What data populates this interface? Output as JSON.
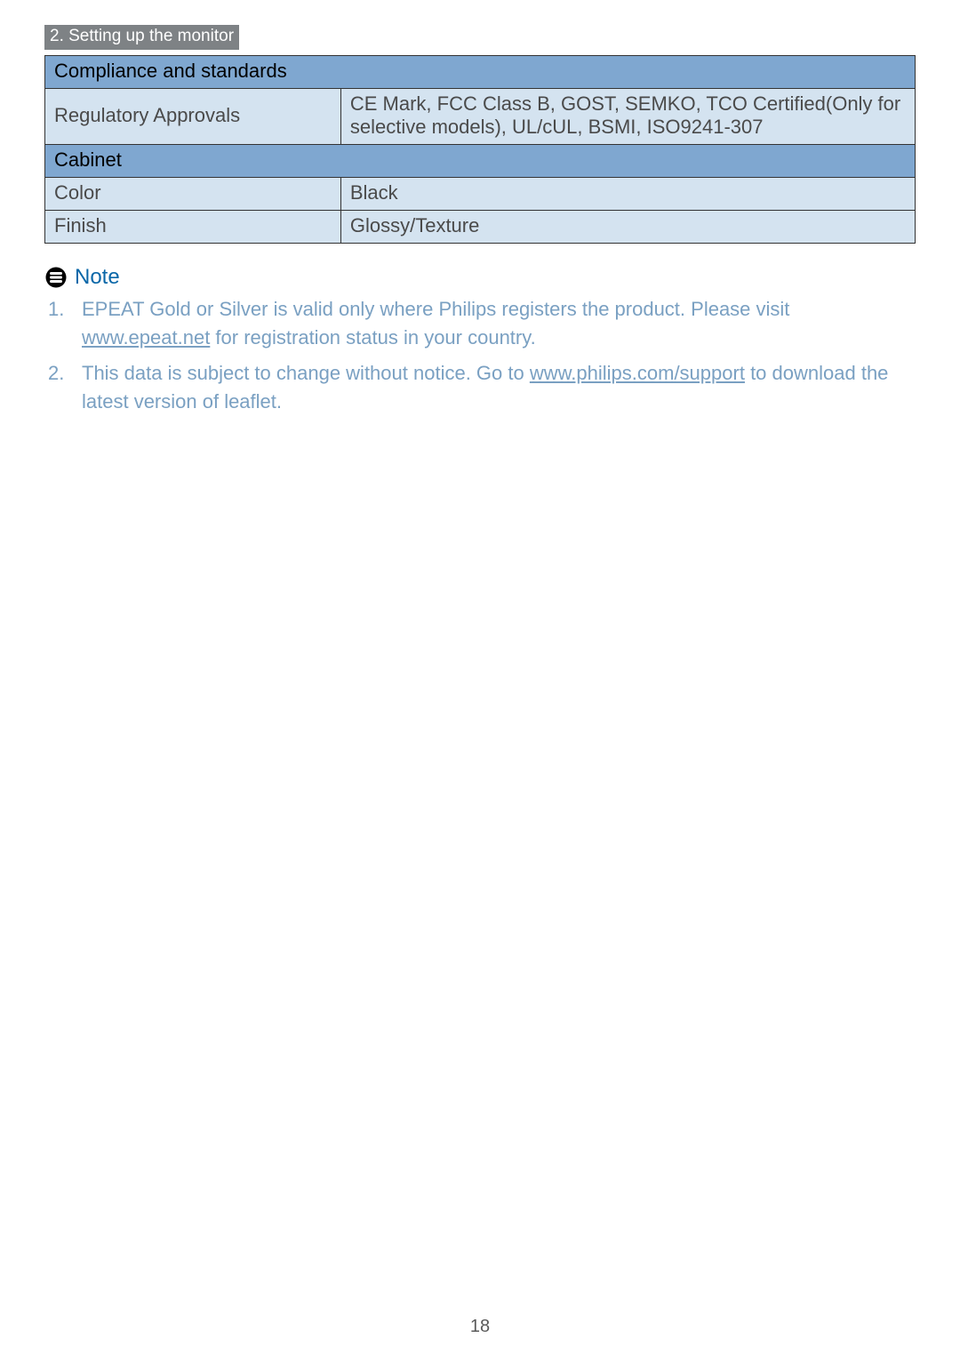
{
  "section_header": "2. Setting up the monitor",
  "table": {
    "group1_header": "Compliance and standards",
    "group1_rows": [
      {
        "label": "Regulatory Approvals",
        "value": "CE Mark, FCC Class B, GOST, SEMKO, TCO Certified(Only for selective models), UL/cUL,  BSMI, ISO9241-307"
      }
    ],
    "group2_header": "Cabinet",
    "group2_rows": [
      {
        "label": "Color",
        "value": "Black"
      },
      {
        "label": "Finish",
        "value": "Glossy/Texture"
      }
    ]
  },
  "note": {
    "title": "Note",
    "items": [
      {
        "pre": "EPEAT Gold or Silver is valid only where Philips registers the product. Please visit ",
        "link": "www.epeat.net",
        "post": " for registration status in your country."
      },
      {
        "pre": "This data is subject to change without notice. Go to ",
        "link": "www.philips.com/support",
        "post": " to download the latest version of leaflet."
      }
    ]
  },
  "page_number": "18"
}
